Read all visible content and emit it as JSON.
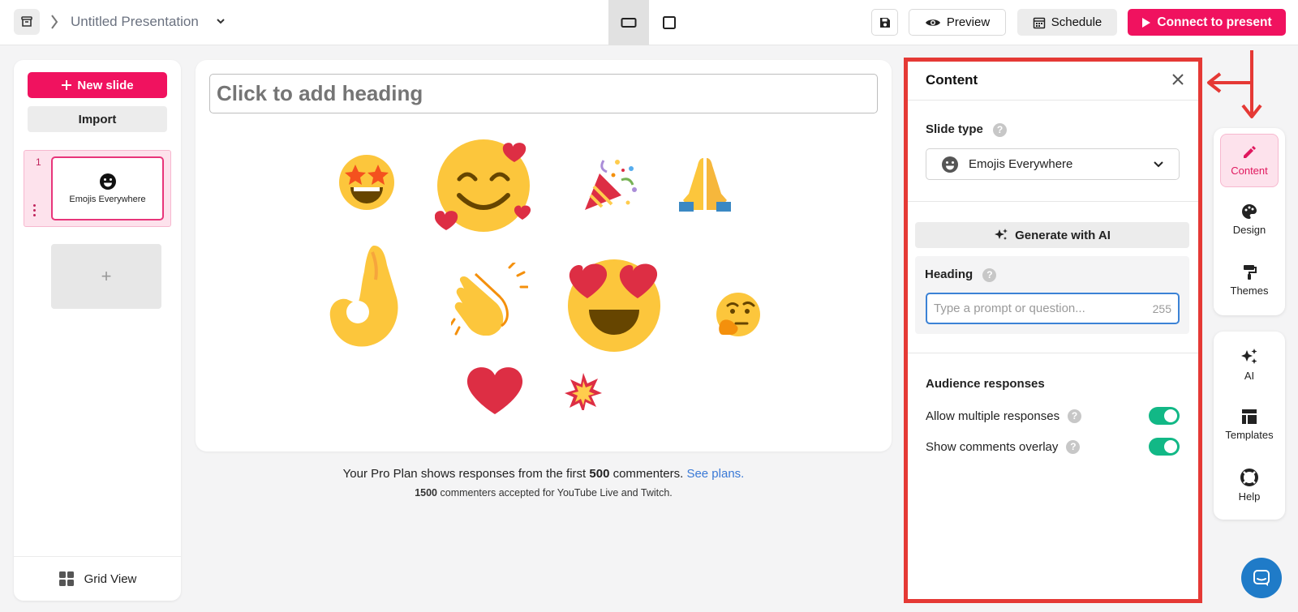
{
  "topbar": {
    "title": "Untitled Presentation",
    "preview_label": "Preview",
    "schedule_label": "Schedule",
    "present_label": "Connect to present"
  },
  "sidebar": {
    "new_slide_label": "New slide",
    "import_label": "Import",
    "slides": [
      {
        "number": "1",
        "label": "Emojis Everywhere"
      }
    ],
    "add_slide_symbol": "+",
    "grid_view_label": "Grid View"
  },
  "canvas": {
    "heading_placeholder": "Click to add heading",
    "emojis": [
      "star-struck",
      "smiling-face-with-hearts",
      "party-popper",
      "folded-hands",
      "ok-hand",
      "clapping-hands",
      "heart-eyes",
      "thinking-face",
      "red-heart",
      "collision"
    ]
  },
  "footer": {
    "line1_pre": "Your Pro Plan shows responses from the first ",
    "line1_bold": "500",
    "line1_post": " commenters. ",
    "line1_link": "See plans.",
    "line2_bold": "1500",
    "line2_post": " commenters accepted for YouTube Live and Twitch."
  },
  "content_panel": {
    "title": "Content",
    "slide_type_label": "Slide type",
    "slide_type_value": "Emojis Everywhere",
    "generate_ai_label": "Generate with AI",
    "heading_label": "Heading",
    "heading_placeholder": "Type a prompt or question...",
    "heading_char_limit": "255",
    "audience_responses_label": "Audience responses",
    "allow_multiple_label": "Allow multiple responses",
    "allow_multiple_on": true,
    "show_overlay_label": "Show comments overlay",
    "show_overlay_on": true,
    "help_symbol": "?"
  },
  "side_tools": {
    "content": "Content",
    "design": "Design",
    "themes": "Themes",
    "ai": "AI",
    "templates": "Templates",
    "help": "Help"
  },
  "colors": {
    "brand_pink": "#f0125f",
    "toggle_green": "#12b886",
    "annotation_red": "#e53935",
    "link_blue": "#3a79d6"
  }
}
